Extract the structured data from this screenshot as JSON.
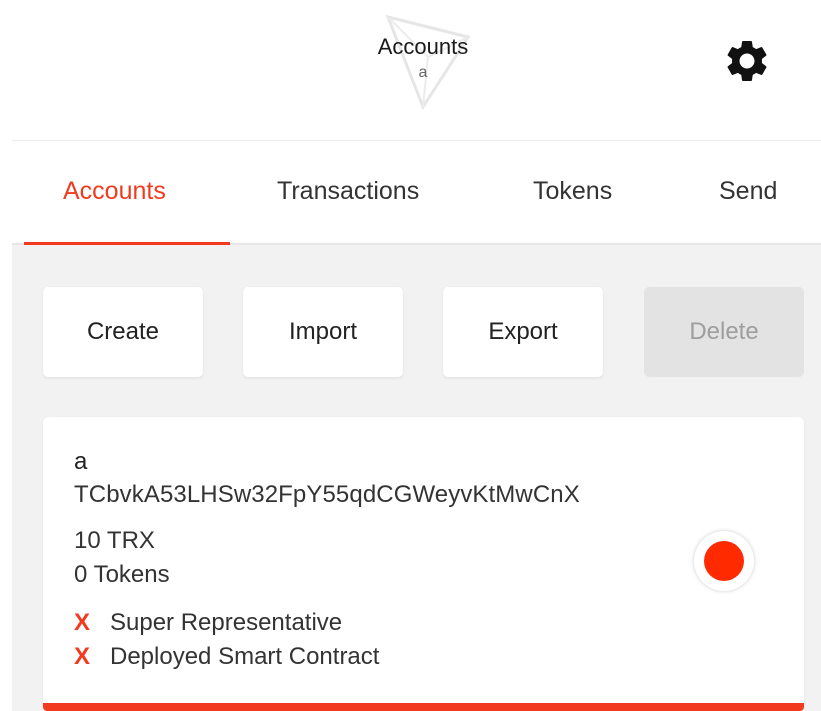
{
  "header": {
    "title": "Accounts",
    "subtitle": "a",
    "settings_icon": "gear-icon",
    "logo": "tron-logo-watermark"
  },
  "tabs": [
    {
      "label": "Accounts",
      "active": true
    },
    {
      "label": "Transactions",
      "active": false
    },
    {
      "label": "Tokens",
      "active": false
    },
    {
      "label": "Send",
      "active": false
    }
  ],
  "actions": {
    "create": "Create",
    "import": "Import",
    "export": "Export",
    "delete": "Delete"
  },
  "account": {
    "name": "a",
    "address": "TCbvkA53LHSw32FpY55qdCGWeyvKtMwCnX",
    "balance": "10 TRX",
    "tokens": "0 Tokens",
    "flags": [
      {
        "mark": "X",
        "label": "Super Representative"
      },
      {
        "mark": "X",
        "label": "Deployed Smart Contract"
      }
    ],
    "status_color": "#ff2a00"
  },
  "colors": {
    "accent": "#f23a1e",
    "background": "#f2f2f2"
  }
}
